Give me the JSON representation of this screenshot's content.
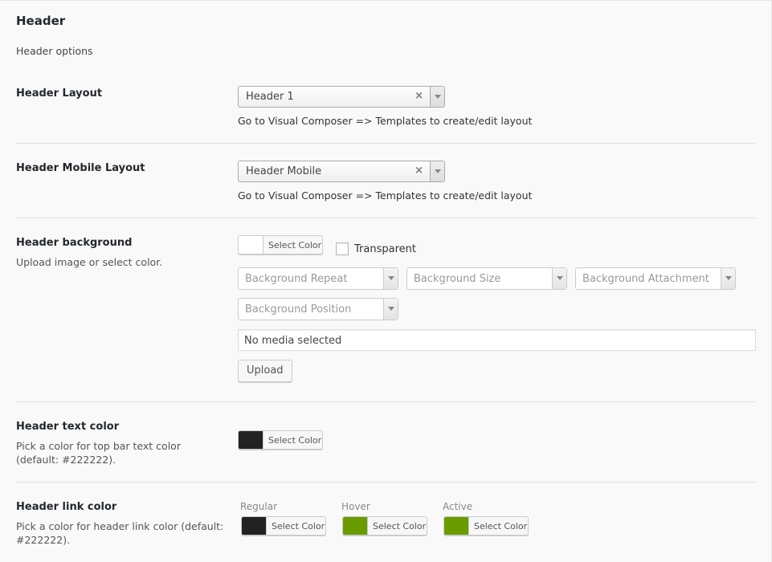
{
  "section": {
    "title": "Header",
    "description": "Header options"
  },
  "header_layout": {
    "label": "Header Layout",
    "selected": "Header 1",
    "clear": "×",
    "help": "Go to Visual Composer => Templates to create/edit layout"
  },
  "header_mobile_layout": {
    "label": "Header Mobile Layout",
    "selected": "Header Mobile",
    "clear": "×",
    "help": "Go to Visual Composer => Templates to create/edit layout"
  },
  "header_background": {
    "label": "Header background",
    "sub": "Upload image or select color.",
    "color_button": "Select Color",
    "swatch_color": "#ffffff",
    "transparent_label": "Transparent",
    "transparent_checked": false,
    "repeat_placeholder": "Background Repeat",
    "size_placeholder": "Background Size",
    "attachment_placeholder": "Background Attachment",
    "position_placeholder": "Background Position",
    "media_text": "No media selected",
    "upload_button": "Upload"
  },
  "header_text_color": {
    "label": "Header text color",
    "sub": "Pick a color for top bar text color (default: #222222).",
    "color_button": "Select Color",
    "swatch_color": "#222222"
  },
  "header_link_color": {
    "label": "Header link color",
    "sub": "Pick a color for header link color (default: #222222).",
    "regular": {
      "label": "Regular",
      "button": "Select Color",
      "swatch_color": "#222222"
    },
    "hover": {
      "label": "Hover",
      "button": "Select Color",
      "swatch_color": "#6a9c00"
    },
    "active": {
      "label": "Active",
      "button": "Select Color",
      "swatch_color": "#6a9c00"
    }
  }
}
